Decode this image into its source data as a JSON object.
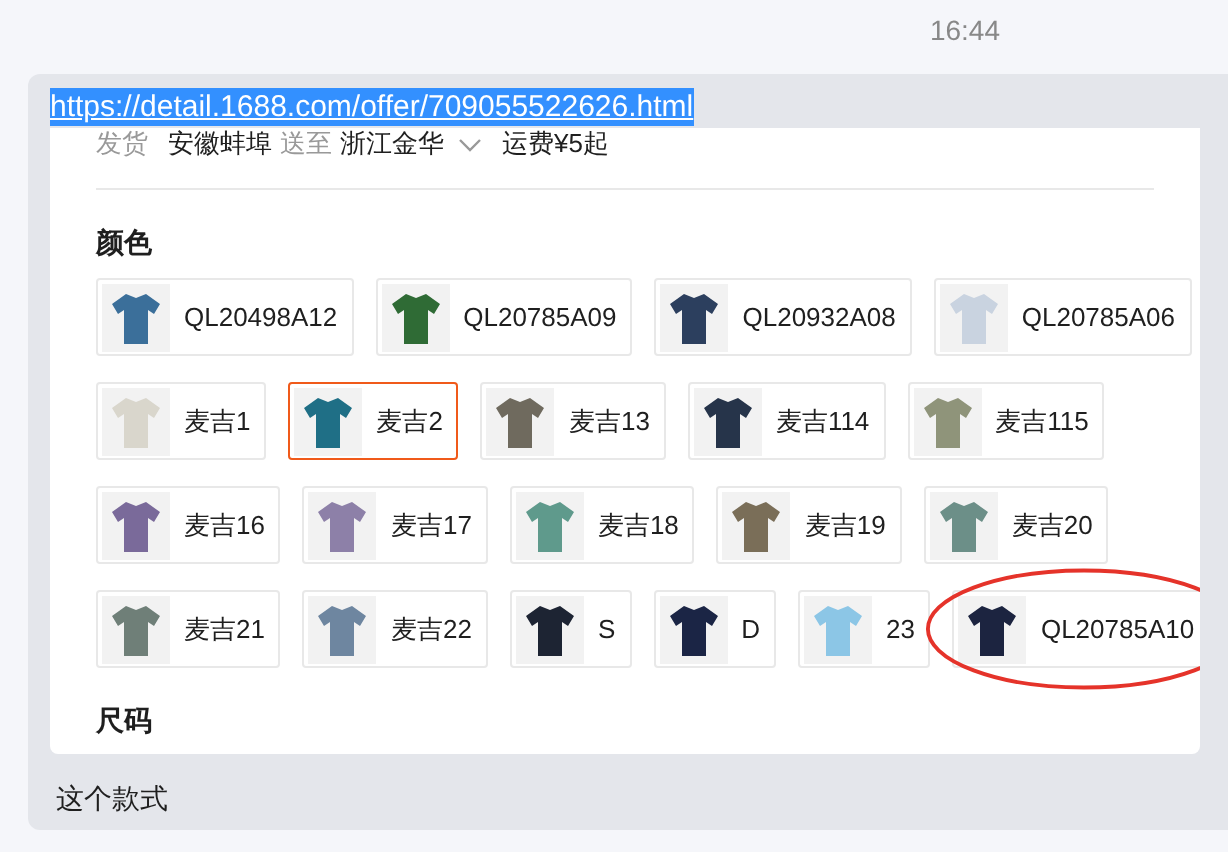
{
  "time": "16:44",
  "message": {
    "link": "https://detail.1688.com/offer/709055522626.html",
    "link_selected": true,
    "product": {
      "shipping": {
        "label": "发货",
        "from": "安徽蚌埠",
        "to_label": "送至",
        "to": "浙江金华",
        "fee": "运费¥5起"
      },
      "color_heading": "颜色",
      "rows": [
        {
          "options": [
            {
              "label": "QL20498A12",
              "color": "#3b6f9a",
              "selected": false,
              "circled": false
            },
            {
              "label": "QL20785A09",
              "color": "#2f6b35",
              "selected": false,
              "circled": false
            },
            {
              "label": "QL20932A08",
              "color": "#2c3f5e",
              "selected": false,
              "circled": false
            },
            {
              "label": "QL20785A06",
              "color": "#c9d3e0",
              "selected": false,
              "circled": false
            }
          ]
        },
        {
          "options": [
            {
              "label": "麦吉1",
              "color": "#d9d6cc",
              "selected": false,
              "circled": false
            },
            {
              "label": "麦吉2",
              "color": "#1f6f86",
              "selected": true,
              "circled": false
            },
            {
              "label": "麦吉13",
              "color": "#6f6a5e",
              "selected": false,
              "circled": false
            },
            {
              "label": "麦吉114",
              "color": "#26344a",
              "selected": false,
              "circled": false
            },
            {
              "label": "麦吉115",
              "color": "#8f947a",
              "selected": false,
              "circled": false
            }
          ]
        },
        {
          "options": [
            {
              "label": "麦吉16",
              "color": "#7a6a9a",
              "selected": false,
              "circled": false
            },
            {
              "label": "麦吉17",
              "color": "#8d80a8",
              "selected": false,
              "circled": false
            },
            {
              "label": "麦吉18",
              "color": "#5f9a8c",
              "selected": false,
              "circled": false
            },
            {
              "label": "麦吉19",
              "color": "#7a6e58",
              "selected": false,
              "circled": false
            },
            {
              "label": "麦吉20",
              "color": "#6c8f88",
              "selected": false,
              "circled": false
            }
          ]
        },
        {
          "options": [
            {
              "label": "麦吉21",
              "color": "#6f7f78",
              "selected": false,
              "circled": false
            },
            {
              "label": "麦吉22",
              "color": "#6e86a0",
              "selected": false,
              "circled": false
            },
            {
              "label": "S",
              "color": "#1d2433",
              "selected": false,
              "circled": false
            },
            {
              "label": "D",
              "color": "#1b2545",
              "selected": false,
              "circled": false
            },
            {
              "label": "23",
              "color": "#8cc6e6",
              "selected": false,
              "circled": false
            },
            {
              "label": "QL20785A10",
              "color": "#1c2440",
              "selected": false,
              "circled": true
            }
          ]
        }
      ],
      "size_heading": "尺码"
    },
    "text": "这个款式"
  }
}
